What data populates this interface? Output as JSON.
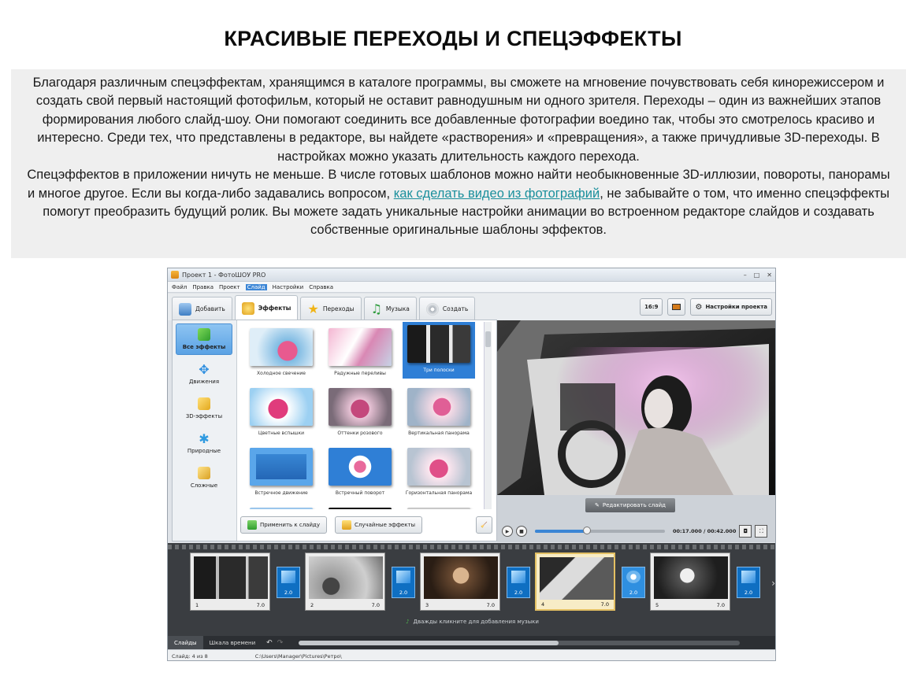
{
  "page": {
    "title": "КРАСИВЫЕ ПЕРЕХОДЫ И СПЕЦЭФФЕКТЫ",
    "article": {
      "p1": "Благодаря различным спецэффектам, хранящимся в каталоге программы, вы сможете на мгновение почувствовать себя кинорежиссером и создать свой первый настоящий фотофильм, который не оставит равнодушным ни одного зрителя. Переходы – один из важнейших этапов формирования любого слайд-шоу. Они помогают соединить все добавленные фотографии воедино так, чтобы это смотрелось красиво и интересно. Среди тех, что представлены в редакторе, вы найдете «растворения» и «превращения», а также причудливые 3D-переходы. В настройках можно указать длительность каждого перехода.",
      "p2_before": "Спецэффектов в приложении ничуть не меньше. В числе готовых шаблонов можно найти необыкновенные 3D-иллюзии, повороты, панорамы и многое другое. Если вы когда-либо задавались вопросом, ",
      "p2_link": "как сделать видео из фотографий",
      "p2_after": ", не забывайте о том, что именно спецэффекты помогут преобразить будущий ролик. Вы можете задать уникальные настройки анимации во встроенном редакторе слайдов и создавать собственные оригинальные шаблоны эффектов."
    }
  },
  "app": {
    "window_title": "Проект 1 - ФотоШОУ PRO",
    "menu": [
      "Файл",
      "Правка",
      "Проект",
      "Слайд",
      "Настройки",
      "Справка"
    ],
    "tabs": [
      "Добавить",
      "Эффекты",
      "Переходы",
      "Музыка",
      "Создать"
    ],
    "toolbar": {
      "ratio": "16:9",
      "settings": "Настройки проекта"
    },
    "categories": [
      "Все эффекты",
      "Движения",
      "3D-эффекты",
      "Природные",
      "Сложные"
    ],
    "effects": [
      "Холодное свечение",
      "Радужные переливы",
      "Три полоски",
      "Цветные вспышки",
      "Оттенки розового",
      "Вертикальная панорама",
      "Встречное движение",
      "Встречный поворот",
      "Горизонтальная панорама"
    ],
    "buttons": {
      "apply": "Применить к слайду",
      "random": "Случайные эффекты",
      "edit_slide": "Редактировать слайд"
    },
    "player": {
      "timecode": "00:17.000 / 00:42.000",
      "progress": 0.4
    },
    "slides": [
      {
        "num": "1",
        "dur": "7.0",
        "tr": "2.0"
      },
      {
        "num": "2",
        "dur": "7.0",
        "tr": "2.0"
      },
      {
        "num": "3",
        "dur": "7.0",
        "tr": "2.0"
      },
      {
        "num": "4",
        "dur": "7.0",
        "tr": "2.0"
      },
      {
        "num": "5",
        "dur": "7.0",
        "tr": "2.0"
      }
    ],
    "music_hint": "Дважды кликните для добавления музыки",
    "bottom_tabs": [
      "Слайды",
      "Шкала времени"
    ],
    "status": {
      "slide": "Слайд: 4 из 8",
      "path": "C:\\Users\\Manager\\Pictures\\Ретро\\"
    }
  }
}
